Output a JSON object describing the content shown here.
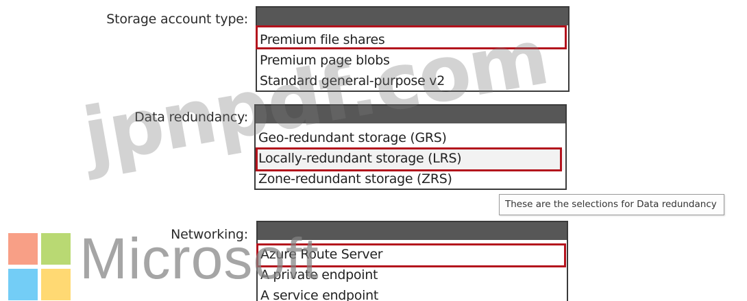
{
  "sections": [
    {
      "label": "Storage account type:",
      "options": [
        "Premium file shares",
        "Premium page blobs",
        "Standard general-purpose v2"
      ],
      "selected": "Premium file shares"
    },
    {
      "label": "Data redundancy:",
      "options": [
        "Geo-redundant storage (GRS)",
        "Locally-redundant storage (LRS)",
        "Zone-redundant storage (ZRS)"
      ],
      "selected": "Locally-redundant storage (LRS)"
    },
    {
      "label": "Networking:",
      "options": [
        "Azure Route Server",
        "A private endpoint",
        "A service endpoint"
      ],
      "selected": "Azure Route Server"
    }
  ],
  "tooltip": "These are the selections for Data redundancy",
  "watermark": {
    "site": "jpnpdf.com",
    "brand": "Microsoft"
  },
  "colors": {
    "selection_border": "#b3121c",
    "dropdown_header": "#575757",
    "logo_red": "#f25022",
    "logo_green": "#7fba00",
    "logo_blue": "#00a4ef",
    "logo_yellow": "#ffb900"
  }
}
